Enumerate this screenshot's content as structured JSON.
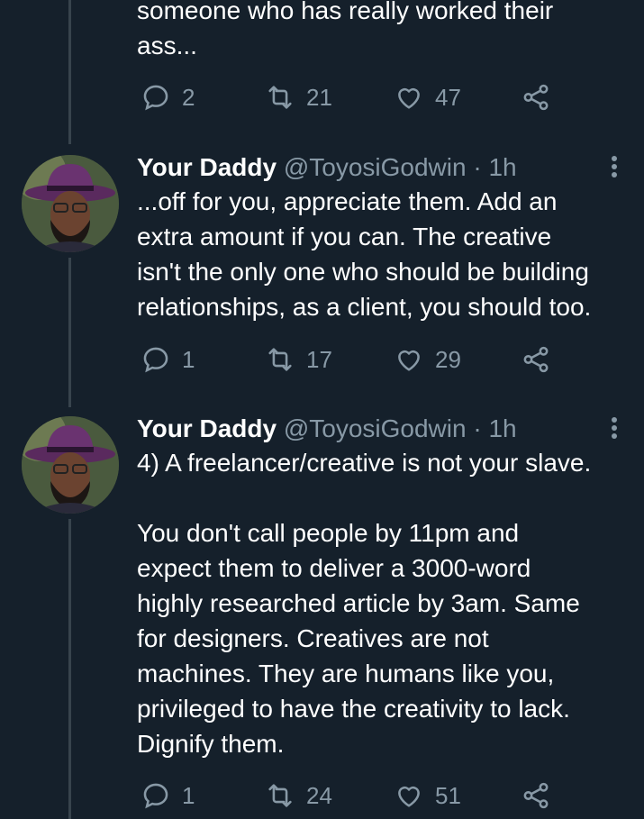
{
  "tweets": [
    {
      "body": "someone who has really worked their\nass...",
      "replies": "2",
      "retweets": "21",
      "likes": "47"
    },
    {
      "name": "Your Daddy",
      "handle": "@ToyosiGodwin · 1h",
      "body": "...off for you, appreciate them. Add an\nextra amount if you can. The creative\nisn't the only one who should be building\nrelationships, as a client, you should too.",
      "replies": "1",
      "retweets": "17",
      "likes": "29"
    },
    {
      "name": "Your Daddy",
      "handle": "@ToyosiGodwin · 1h",
      "body": "4) A freelancer/creative is not your slave.\n\nYou don't call people by 11pm and\nexpect them to deliver a 3000-word\nhighly researched article by 3am. Same\nfor designers. Creatives are not\nmachines. They are humans like you,\nprivileged to have the creativity to lack.\nDignify them.",
      "replies": "1",
      "retweets": "24",
      "likes": "51"
    }
  ],
  "colors": {
    "background": "#15202b",
    "muted": "#8899a6",
    "thread_line": "#38444d"
  },
  "icons": [
    "reply-icon",
    "retweet-icon",
    "like-icon",
    "share-icon",
    "more-menu-icon"
  ]
}
